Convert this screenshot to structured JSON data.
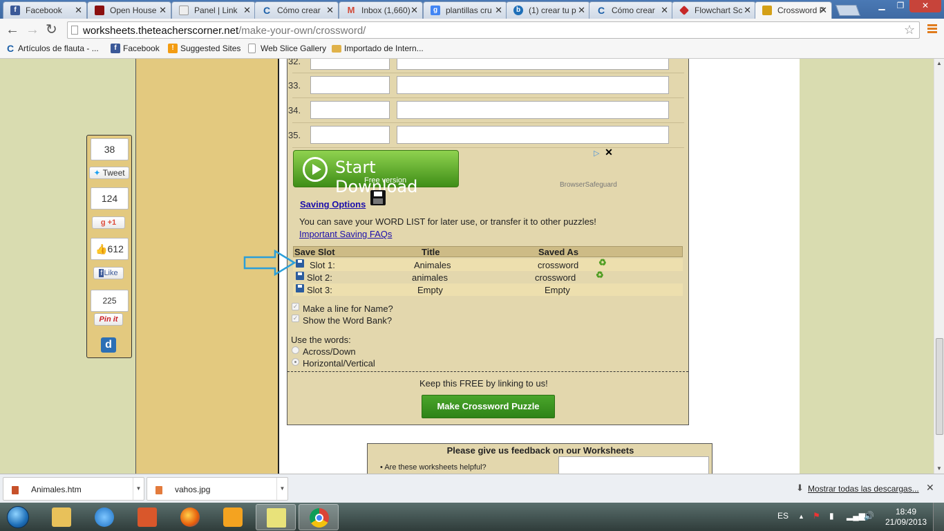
{
  "browser": {
    "tabs": [
      {
        "title": "Facebook",
        "icon": "facebook-icon",
        "color": "#3b5998"
      },
      {
        "title": "Open House",
        "icon": "openhouse-icon",
        "color": "#8b1010"
      },
      {
        "title": "Panel | Link",
        "icon": "page-icon",
        "color": "#cccccc"
      },
      {
        "title": "Cómo crear",
        "icon": "c-icon",
        "color": "#1b5fa8"
      },
      {
        "title": "Inbox (1,660)",
        "icon": "gmail-icon",
        "color": "#d14836"
      },
      {
        "title": "plantillas cru",
        "icon": "google-icon",
        "color": "#4285f4"
      },
      {
        "title": "(1) crear tu p",
        "icon": "b-icon",
        "color": "#1e6fb8"
      },
      {
        "title": "Cómo crear",
        "icon": "c-icon",
        "color": "#1b5fa8"
      },
      {
        "title": "Flowchart Sc",
        "icon": "flowchart-icon",
        "color": "#c62828"
      },
      {
        "title": "Crossword P",
        "icon": "crossword-icon",
        "color": "#d4a017"
      }
    ],
    "url_host": "worksheets.theteacherscorner.net",
    "url_path": "/make-your-own/crossword/",
    "bookmarks": [
      {
        "label": "Artículos de flauta - ...",
        "icon": "c-icon",
        "color": "#1b5fa8"
      },
      {
        "label": "Facebook",
        "icon": "facebook-icon",
        "color": "#3b5998"
      },
      {
        "label": "Suggested Sites",
        "icon": "ie-icon",
        "color": "#f39c12"
      },
      {
        "label": "Web Slice Gallery",
        "icon": "page-icon",
        "color": "#999999"
      },
      {
        "label": "Importado de Intern...",
        "icon": "folder-icon",
        "color": "#e0b24a"
      }
    ]
  },
  "social": {
    "tweet_count": "38",
    "tweet_label": "Tweet",
    "gplus_count": "124",
    "gplus_label": "+1",
    "like_count": "612",
    "like_label": "Like",
    "pin_count": "225",
    "pin_label": "Pin it"
  },
  "rows": [
    "32.",
    "33.",
    "34.",
    "35."
  ],
  "ad": {
    "title": "Start Download",
    "subtitle": "Free version",
    "source": "BrowserSafeguard"
  },
  "saving": {
    "heading": "Saving Options",
    "description": "You can save your WORD LIST for later use, or transfer it to other puzzles!",
    "faq_link": "Important Saving FAQs",
    "headers": {
      "slot": "Save Slot",
      "title": "Title",
      "saved_as": "Saved As"
    },
    "slots": [
      {
        "slot": "Slot 1:",
        "title": "Animales",
        "saved_as": "crossword"
      },
      {
        "slot": "Slot 2:",
        "title": "animales",
        "saved_as": "crossword"
      },
      {
        "slot": "Slot 3:",
        "title": "Empty",
        "saved_as": "Empty"
      }
    ]
  },
  "options": {
    "name_line": "Make a line for Name?",
    "word_bank": "Show the Word Bank?",
    "use_words": "Use the words:",
    "across_down": "Across/Down",
    "horizontal_vertical": "Horizontal/Vertical"
  },
  "footer": {
    "link_text": "Keep this FREE by linking to us!",
    "make_button": "Make Crossword Puzzle"
  },
  "feedback": {
    "title": "Please give us feedback on our Worksheets",
    "question": "Are these worksheets helpful?"
  },
  "downloads": {
    "items": [
      "Animales.htm",
      "vahos.jpg"
    ],
    "show_all": "Mostrar todas las descargas..."
  },
  "taskbar": {
    "lang": "ES",
    "time": "18:49",
    "date": "21/09/2013"
  }
}
